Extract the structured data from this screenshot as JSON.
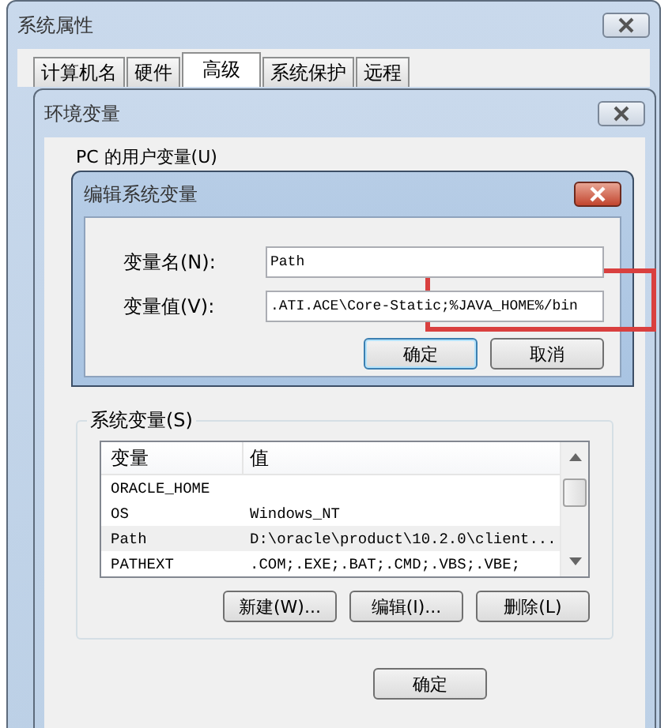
{
  "window": {
    "title": "系统属性"
  },
  "tabs": [
    {
      "label": "计算机名",
      "selected": false
    },
    {
      "label": "硬件",
      "selected": false
    },
    {
      "label": "高级",
      "selected": true
    },
    {
      "label": "系统保护",
      "selected": false
    },
    {
      "label": "远程",
      "selected": false
    }
  ],
  "env_window": {
    "title": "环境变量",
    "user_vars_label": "PC 的用户变量(U)",
    "system_vars_label": "系统变量(S)",
    "columns": [
      "变量",
      "值"
    ],
    "rows": [
      {
        "name": "ORACLE_HOME",
        "value": "",
        "selected": false
      },
      {
        "name": "OS",
        "value": "Windows_NT",
        "selected": false
      },
      {
        "name": "Path",
        "value": "D:\\oracle\\product\\10.2.0\\client...",
        "selected": true
      },
      {
        "name": "PATHEXT",
        "value": ".COM;.EXE;.BAT;.CMD;.VBS;.VBE;",
        "selected": false
      }
    ],
    "buttons": [
      "新建(W)...",
      "编辑(I)...",
      "删除(L)"
    ],
    "ok_button": "确定"
  },
  "edit_dialog": {
    "title": "编辑系统变量",
    "fields": [
      {
        "label": "变量名(N):",
        "value": "Path"
      },
      {
        "label": "变量值(V):",
        "value": ".ATI.ACE\\Core-Static;%JAVA_HOME%/bin"
      }
    ],
    "buttons": [
      {
        "label": "确定",
        "default": true
      },
      {
        "label": "取消",
        "default": false
      }
    ]
  }
}
